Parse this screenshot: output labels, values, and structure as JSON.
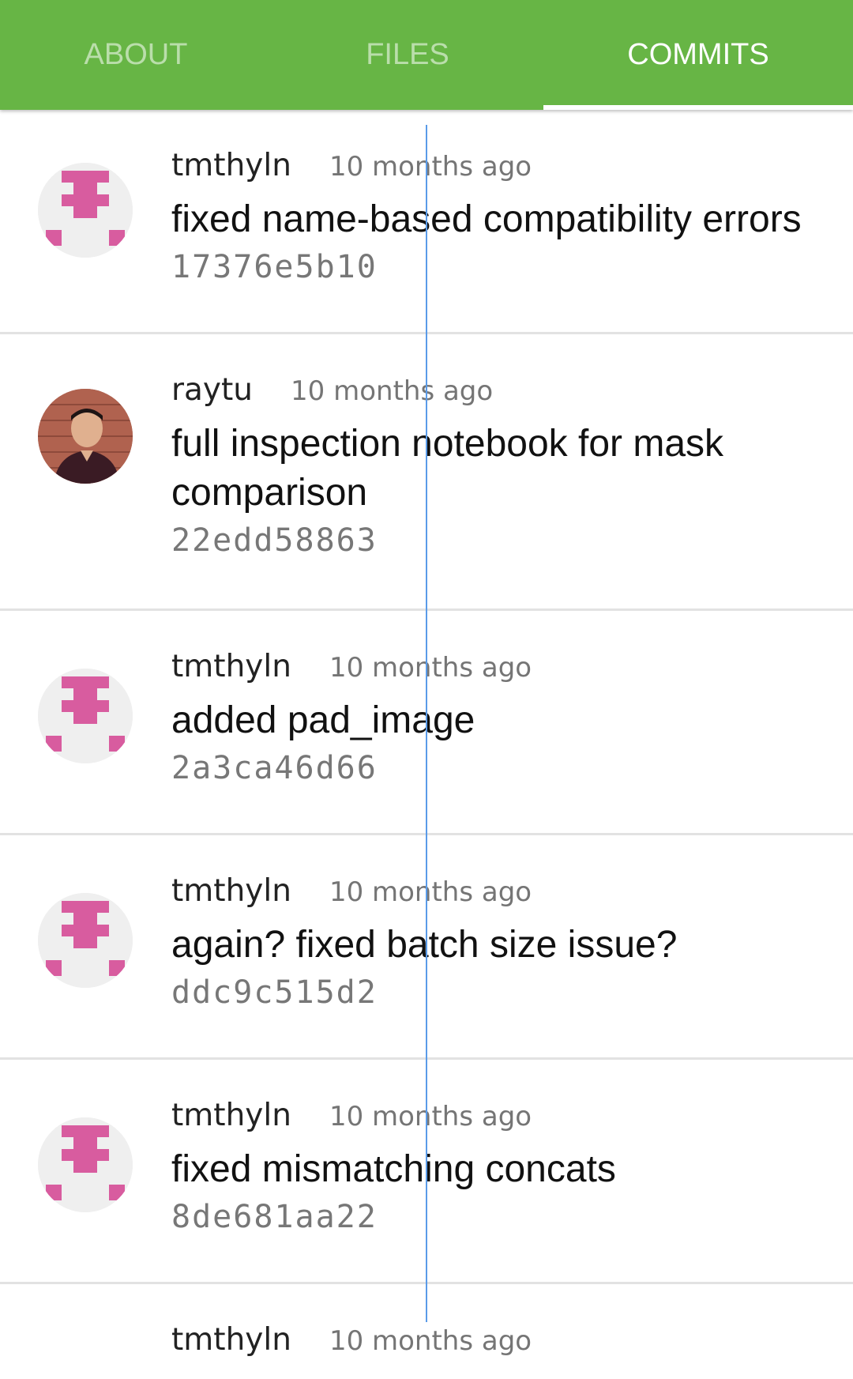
{
  "tabs": [
    {
      "label": "ABOUT",
      "active": false
    },
    {
      "label": "FILES",
      "active": false
    },
    {
      "label": "COMMITS",
      "active": true
    }
  ],
  "colors": {
    "tab_bar": "#67b545",
    "identicon": "#d85c9f",
    "divider": "#e2e2e2",
    "guide_line": "#5a9be8"
  },
  "commits": [
    {
      "author": "tmthyln",
      "time": "10 months ago",
      "message": "fixed name-based compatibility errors",
      "sha": "17376e5b10",
      "avatar": "identicon"
    },
    {
      "author": "raytu",
      "time": "10 months ago",
      "message": "full inspection notebook for mask comparison",
      "sha": "22edd58863",
      "avatar": "photo"
    },
    {
      "author": "tmthyln",
      "time": "10 months ago",
      "message": "added pad_image",
      "sha": "2a3ca46d66",
      "avatar": "identicon"
    },
    {
      "author": "tmthyln",
      "time": "10 months ago",
      "message": "again? fixed batch size issue?",
      "sha": "ddc9c515d2",
      "avatar": "identicon"
    },
    {
      "author": "tmthyln",
      "time": "10 months ago",
      "message": "fixed mismatching concats",
      "sha": "8de681aa22",
      "avatar": "identicon"
    }
  ],
  "partial_commit": {
    "author": "tmthyln",
    "time": "10 months ago"
  }
}
